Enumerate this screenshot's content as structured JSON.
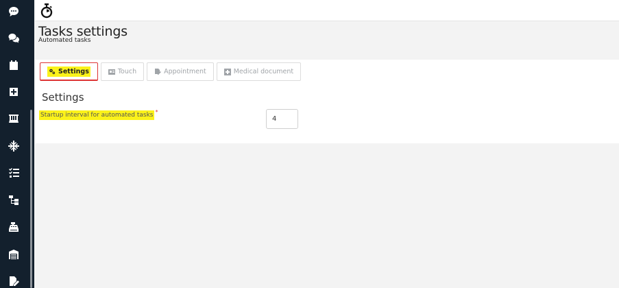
{
  "sidebar": {
    "icons": [
      "chat-icon",
      "conversations-icon",
      "calendar-icon",
      "medical-plus-icon",
      "lab-flask-icon",
      "snowflake-icon",
      "checklist-icon",
      "hierarchy-icon",
      "cash-register-icon",
      "warehouse-icon",
      "document-edit-icon"
    ]
  },
  "page": {
    "title": "Tasks settings",
    "subtitle": "Automated tasks"
  },
  "tabs": [
    {
      "label": "Settings",
      "icon": "gears-icon",
      "active": true
    },
    {
      "label": "Touch",
      "icon": "id-card-icon",
      "active": false
    },
    {
      "label": "Appointment",
      "icon": "file-signature-icon",
      "active": false
    },
    {
      "label": "Medical document",
      "icon": "plus-square-icon",
      "active": false
    }
  ],
  "settings": {
    "section_title": "Settings",
    "field_label": "Startup interval for automated tasks",
    "required_mark": "*",
    "field_value": "4"
  },
  "colors": {
    "sidebar_bg": "#13202d",
    "highlight": "#fbf21a",
    "active_tab_border": "#dd3333"
  }
}
